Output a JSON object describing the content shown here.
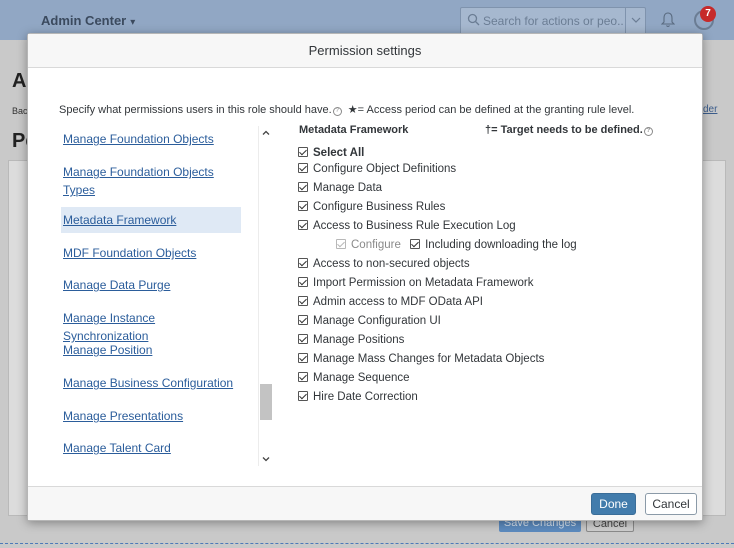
{
  "shell": {
    "title": "Admin Center",
    "search_placeholder": "Search for actions or peo...",
    "notification_count": "7"
  },
  "background": {
    "heading_a": "A",
    "heading_pe": "Pe",
    "breadcrumb_fragment": "Bac",
    "link_fragment": "der",
    "save_label": "Save Changes",
    "cancel_label": "Cancel"
  },
  "dialog": {
    "title": "Permission settings",
    "intro_text": "Specify what permissions users in this role should have.",
    "intro_note": "★= Access period can be defined at the granting rule level.",
    "categories": [
      {
        "label": "Manage Foundation Objects",
        "selected": false
      },
      {
        "label": "Manage Foundation Objects Types",
        "selected": false
      },
      {
        "label": "Metadata Framework",
        "selected": true
      },
      {
        "label": "MDF Foundation Objects",
        "selected": false
      },
      {
        "label": "Manage Data Purge",
        "selected": false
      },
      {
        "label": "Manage Instance Synchronization",
        "selected": false
      },
      {
        "label": "Manage Position",
        "selected": false
      },
      {
        "label": "Manage Business Configuration",
        "selected": false
      },
      {
        "label": "Manage Presentations",
        "selected": false
      },
      {
        "label": "Manage Talent Card",
        "selected": false
      }
    ],
    "permissions_heading": "Metadata Framework",
    "target_note": "†= Target needs to be defined.",
    "select_all": "Select All",
    "permissions": [
      "Configure Object Definitions",
      "Manage Data",
      "Configure Business Rules",
      "Access to Business Rule Execution Log"
    ],
    "sub_permission": {
      "configure_label": "Configure",
      "including_label": "Including downloading the log"
    },
    "permissions_more": [
      "Access to non-secured objects",
      "Import Permission on Metadata Framework",
      "Admin access to MDF OData API",
      "Manage Configuration UI",
      "Manage Positions",
      "Manage Mass Changes for Metadata Objects",
      "Manage Sequence",
      "Hire Date Correction"
    ],
    "done_label": "Done",
    "cancel_label": "Cancel"
  },
  "colors": {
    "shellbar": "#91a7c4",
    "link": "#2b5d9b",
    "selected_bg": "#dfe9f5",
    "primary_button": "#427cac",
    "badge": "#c62a2a"
  }
}
